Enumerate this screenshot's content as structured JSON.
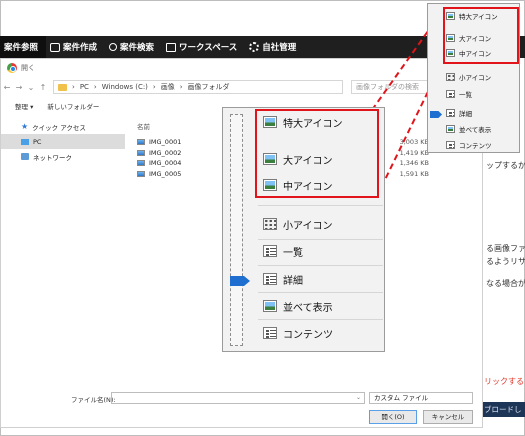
{
  "app": {
    "nav": [
      {
        "label": "案件参照",
        "icon": "none"
      },
      {
        "label": "案件作成",
        "icon": "person-card-icon"
      },
      {
        "label": "案件検索",
        "icon": "search-icon"
      },
      {
        "label": "ワークスペース",
        "icon": "board-icon"
      },
      {
        "label": "自社管理",
        "icon": "gear-icon"
      }
    ]
  },
  "dialog": {
    "title": "開く",
    "path": [
      "PC",
      "Windows (C:)",
      "画像",
      "画像フォルダ"
    ],
    "search_placeholder": "画像フォルダの検索",
    "toolbar": {
      "organize": "整理 ▾",
      "new_folder": "新しいフォルダー"
    },
    "sidebar": [
      {
        "label": "クイック アクセス",
        "icon": "star-icon"
      },
      {
        "label": "PC",
        "icon": "pc-icon",
        "selected": true
      },
      {
        "label": "ネットワーク",
        "icon": "network-icon"
      }
    ],
    "columns": {
      "name": "名前"
    },
    "files": [
      {
        "name": "IMG_0001",
        "size": "3,003 KB"
      },
      {
        "name": "IMG_0002",
        "size": "1,419 KB"
      },
      {
        "name": "IMG_0004",
        "size": "1,346 KB"
      },
      {
        "name": "IMG_0005",
        "size": "1,591 KB"
      }
    ],
    "filename_label": "ファイル名(N):",
    "filter": "カスタム ファイル",
    "open_button": "開く(O)",
    "cancel_button": "キャンセル"
  },
  "page_text": {
    "line1": "ップするか",
    "line2": "る画像ファ",
    "line3": "るようリサー",
    "line4": "なる場合が",
    "red_text": "リックすると",
    "download_bar": "ブロードし"
  },
  "view_menu": {
    "items": [
      {
        "label": "特大アイコン",
        "icon": "extra-large-icons-icon"
      },
      {
        "label": "大アイコン",
        "icon": "large-icons-icon"
      },
      {
        "label": "中アイコン",
        "icon": "medium-icons-icon"
      },
      {
        "label": "小アイコン",
        "icon": "small-icons-icon"
      },
      {
        "label": "一覧",
        "icon": "list-icon"
      },
      {
        "label": "詳細",
        "icon": "details-icon"
      },
      {
        "label": "並べて表示",
        "icon": "tiles-icon"
      },
      {
        "label": "コンテンツ",
        "icon": "content-icon"
      }
    ]
  },
  "colors": {
    "highlight": "#e0141a",
    "accent": "#1e6fd0",
    "topbar": "#1f1f1f"
  }
}
